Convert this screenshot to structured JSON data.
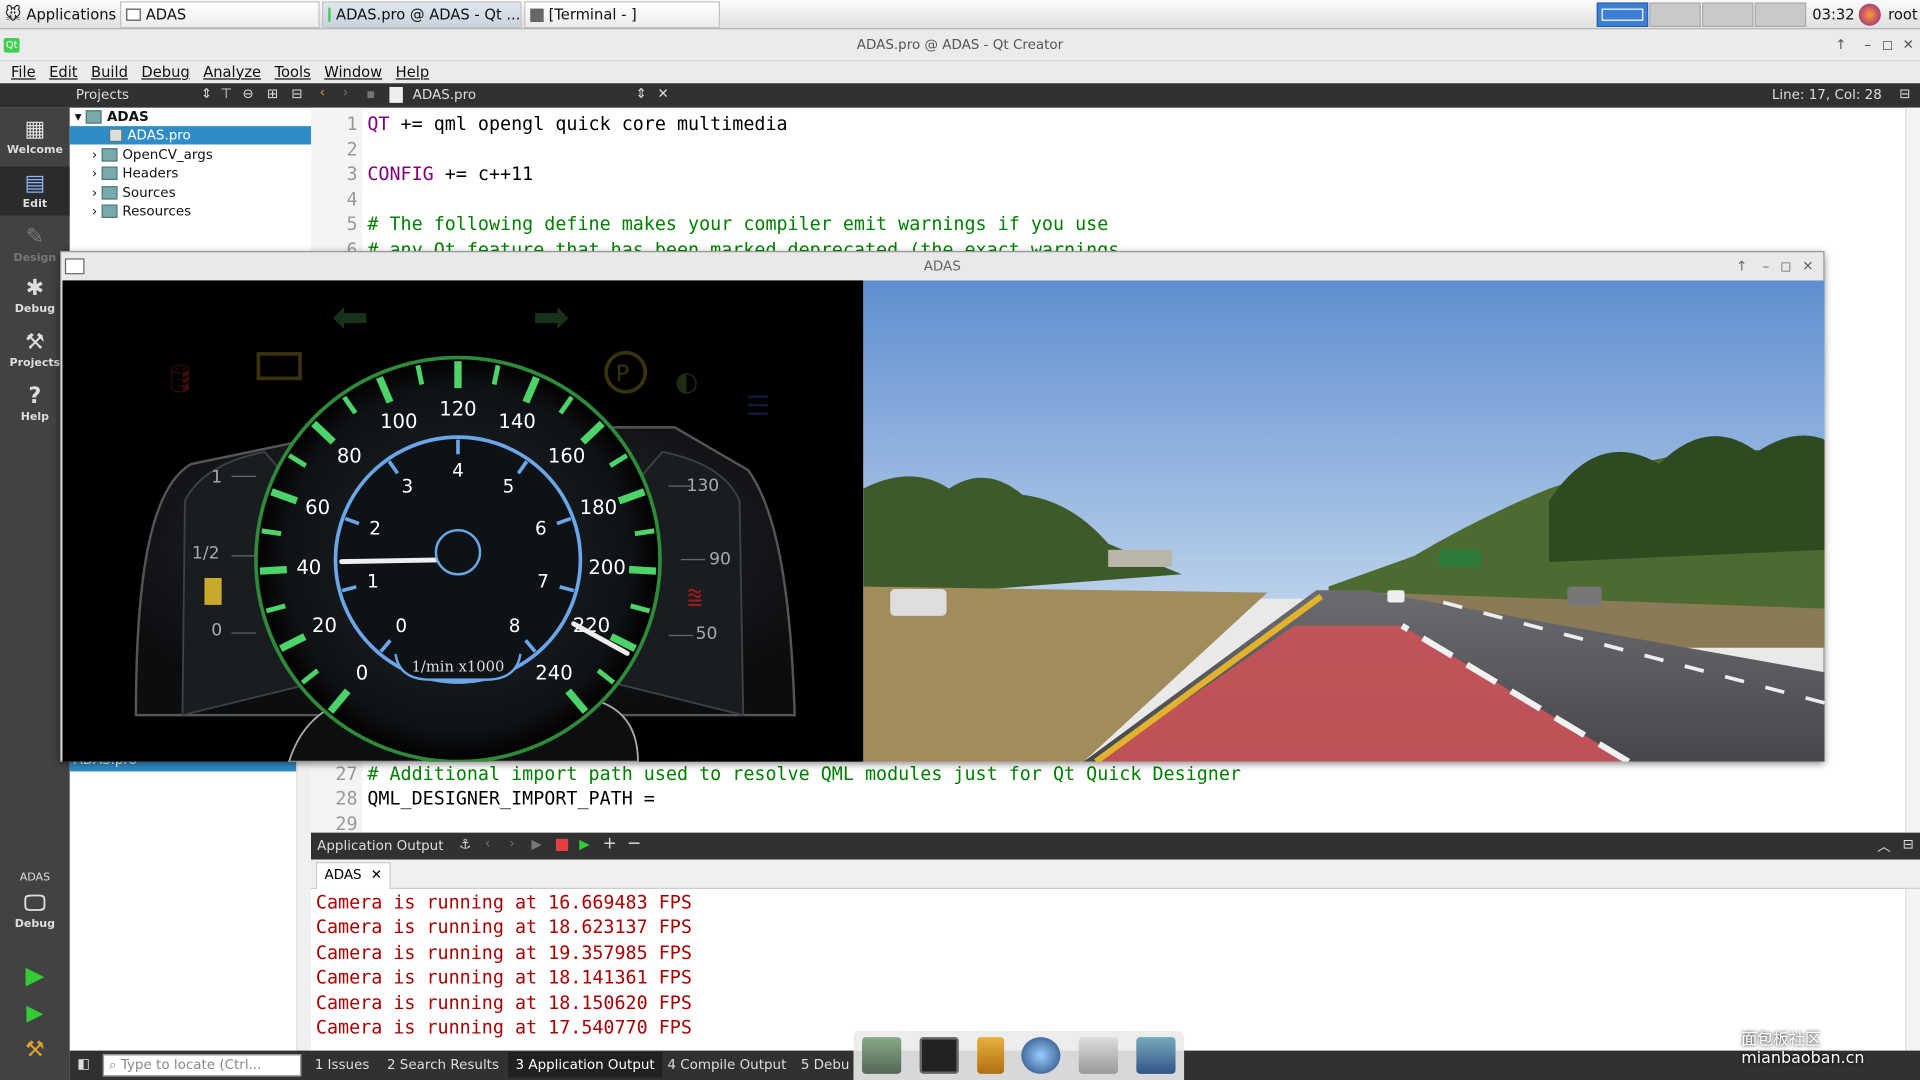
{
  "taskbar": {
    "applications": "Applications",
    "windows": [
      "ADAS",
      "ADAS.pro @ ADAS - Qt ...",
      "[Terminal - ]"
    ],
    "clock": "03:32",
    "user": "root"
  },
  "window_title": "ADAS.pro @ ADAS - Qt Creator",
  "menu": [
    "File",
    "Edit",
    "Build",
    "Debug",
    "Analyze",
    "Tools",
    "Window",
    "Help"
  ],
  "modes": [
    "Welcome",
    "Edit",
    "Design",
    "Debug",
    "Projects",
    "Help"
  ],
  "kit": {
    "project": "ADAS",
    "mode": "Debug"
  },
  "toolbar": {
    "projects_label": "Projects",
    "open_file": "ADAS.pro",
    "cursor_position": "Line: 17, Col: 28"
  },
  "tree": {
    "root": "ADAS",
    "selected": "ADAS.pro",
    "children": [
      "OpenCV_args",
      "Headers",
      "Sources",
      "Resources"
    ],
    "open_documents_item": "ADAS.pro"
  },
  "editor": {
    "line_numbers": [
      "1",
      "2",
      "3",
      "4",
      "5",
      "6",
      "27",
      "28",
      "29"
    ],
    "lines": [
      {
        "kw": "QT",
        "rest": " += qml opengl quick core multimedia"
      },
      {
        "kw": "",
        "rest": ""
      },
      {
        "kw": "CONFIG",
        "rest": " += c++11"
      },
      {
        "kw": "",
        "rest": ""
      },
      {
        "comment": "# The following define makes your compiler emit warnings if you use"
      },
      {
        "comment": "# any Qt feature that has been marked deprecated (the exact warnings"
      }
    ],
    "lower_lines": [
      {
        "comment": "# Additional import path used to resolve QML modules just for Qt Quick Designer"
      },
      {
        "text": "QML_DESIGNER_IMPORT_PATH ="
      },
      {
        "text": ""
      }
    ]
  },
  "adas_window": {
    "title": "ADAS",
    "speed_labels": [
      "0",
      "20",
      "40",
      "60",
      "80",
      "100",
      "120",
      "140",
      "160",
      "180",
      "200",
      "220",
      "240"
    ],
    "rpm_labels": [
      "0",
      "1",
      "2",
      "3",
      "4",
      "5",
      "6",
      "7",
      "8"
    ],
    "rpm_unit": "1/min x1000",
    "fuel_labels": [
      "1",
      "1/2",
      "0"
    ],
    "temp_labels": [
      "130",
      "90",
      "50"
    ],
    "speed_value": 222,
    "rpm_value": 1.4
  },
  "output": {
    "header": "Application Output",
    "tab": "ADAS",
    "lines": [
      "Camera is running at 16.669483 FPS",
      "Camera is running at 18.623137 FPS",
      "Camera is running at 19.357985 FPS",
      "Camera is running at 18.141361 FPS",
      "Camera is running at 18.150620 FPS",
      "Camera is running at 17.540770 FPS"
    ]
  },
  "statusbar": {
    "locator_placeholder": "Type to locate (Ctrl...",
    "panes": [
      "1  Issues",
      "2  Search Results",
      "3  Application Output",
      "4  Compile Output",
      "5  Debu"
    ]
  },
  "watermark": "面包板社区 mianbaoban.cn"
}
